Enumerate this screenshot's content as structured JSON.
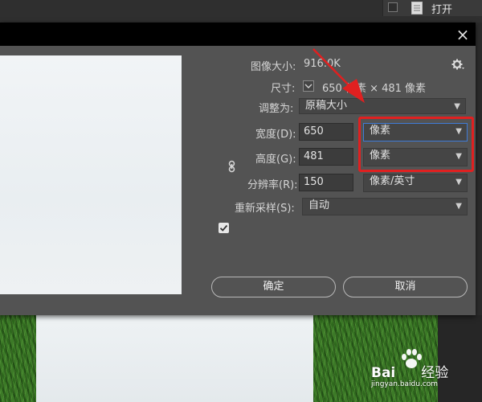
{
  "layers_panel": {
    "item_label": "打开"
  },
  "dialog": {
    "image_size_label": "图像大小:",
    "image_size_value": "916.0K",
    "dimensions_label": "尺寸:",
    "dimensions_value": "650 像素 × 481 像素",
    "fit_to_label": "调整为:",
    "fit_to_value": "原稿大小",
    "width_label": "宽度(D):",
    "width_value": "650",
    "width_unit": "像素",
    "height_label": "高度(G):",
    "height_value": "481",
    "height_unit": "像素",
    "resolution_label": "分辨率(R):",
    "resolution_value": "150",
    "resolution_unit": "像素/英寸",
    "resample_label": "重新采样(S):",
    "resample_value": "自动",
    "ok_label": "确定",
    "cancel_label": "取消",
    "close_glyph": "×"
  },
  "watermark": {
    "logo_part1": "Bai",
    "logo_part2": "经验",
    "url": "jingyan.baidu.com"
  },
  "colors": {
    "dialog_bg": "#535353",
    "highlight": "#e02020",
    "focus_border": "#3f7bd6"
  }
}
